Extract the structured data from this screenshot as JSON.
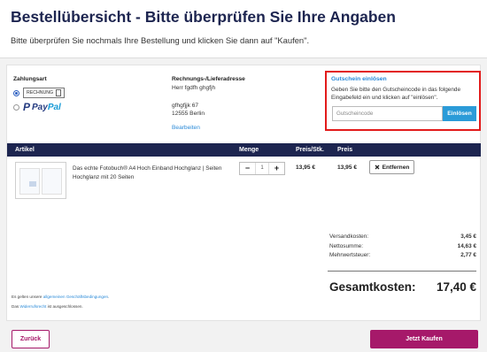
{
  "header": {
    "title": "Bestellübersicht - Bitte überprüfen Sie Ihre Angaben",
    "subtitle": "Bitte überprüfen Sie nochmals Ihre Bestellung und klicken Sie dann auf \"Kaufen\"."
  },
  "payment": {
    "label": "Zahlungsart",
    "options": [
      {
        "label": "RECHNUNG",
        "selected": true
      },
      {
        "label_a": "Pay",
        "label_b": "Pal",
        "selected": false
      }
    ]
  },
  "address": {
    "label": "Rechnungs-/Lieferadresse",
    "name": "Herr fgdfh ghgfjh",
    "street": "gfhgfjjk 67",
    "city": "12555 Berlin",
    "edit_link": "Bearbeiten"
  },
  "voucher": {
    "title": "Gutschein einlösen",
    "text": "Geben Sie bitte den Gutscheincode in das folgende Eingabefeld ein und klicken auf \"einlösen\".",
    "placeholder": "Gutscheincode",
    "button": "Einlösen"
  },
  "table": {
    "headers": {
      "article": "Artikel",
      "quantity": "Menge",
      "unit_price": "Preis/Stk.",
      "price": "Preis"
    },
    "rows": [
      {
        "name": "Das echte Fotobuch® A4 Hoch Einband Hochglanz | Seiten Hochglanz mit 20 Seiten",
        "quantity": "1",
        "minus": "−",
        "plus": "+",
        "unit_price": "13,95 €",
        "price": "13,95 €",
        "remove": "Entfernen"
      }
    ]
  },
  "summary": {
    "shipping_label": "Versandkosten:",
    "shipping": "3,45 €",
    "net_label": "Nettosumme:",
    "net": "14,63 €",
    "vat_label": "Mehrwertsteuer:",
    "vat": "2,77 €",
    "total_label": "Gesamtkosten:",
    "total": "17,40 €"
  },
  "legal": {
    "terms_prefix": "Es gelten unsere",
    "terms_link": "allgemeinen Geschäftsbedingungen",
    "terms_suffix": ".",
    "withdrawal_prefix": "Das",
    "withdrawal_link": "Widerrufsrecht",
    "withdrawal_suffix": "ist ausgeschlossen."
  },
  "actions": {
    "back": "Zurück",
    "buy": "Jetzt Kaufen"
  },
  "colors": {
    "navy": "#1d2550",
    "accent": "#a6196a",
    "link": "#2a8ad8",
    "highlight": "#e21b1b"
  },
  "icons": {
    "remove": "close-icon",
    "invoice": "invoice-icon"
  }
}
